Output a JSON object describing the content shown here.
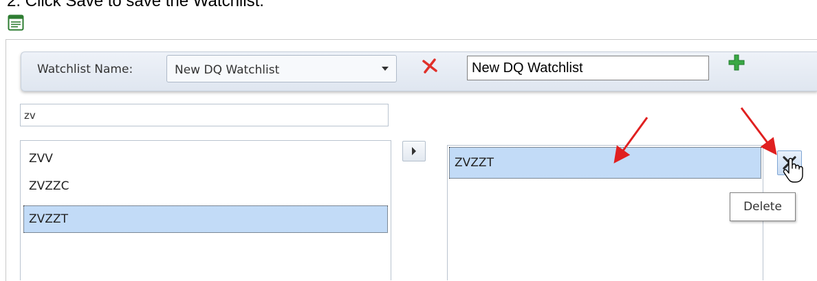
{
  "instruction": {
    "text": "2.  Click Save to save the Watchlist."
  },
  "toolbar": {
    "label": "Watchlist Name:",
    "selected_watchlist": "New DQ Watchlist",
    "name_value": "New DQ Watchlist",
    "icons": {
      "delete": "red-x-icon",
      "add": "green-plus-icon"
    }
  },
  "search": {
    "value": "zv"
  },
  "available_symbols": [
    "ZVV",
    "ZVZZC",
    "ZVZZT"
  ],
  "selected_available": "ZVZZT",
  "watchlist_symbols": [
    "ZVZZT"
  ],
  "remove_button": {
    "icon": "x-icon"
  },
  "tooltip": {
    "text": "Delete"
  },
  "colors": {
    "selection": "#c2dbf7",
    "annotation_arrow": "#e02020",
    "delete_red": "#e0302a",
    "add_green": "#3aa845"
  }
}
